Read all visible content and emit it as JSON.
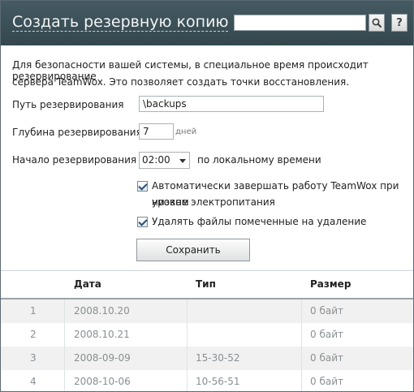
{
  "header": {
    "title": "Создать резервную копию",
    "search_placeholder": "",
    "search_icon": "search-icon",
    "help_label": "?"
  },
  "form": {
    "description_line1": "Для безопасности вашей системы, в специальное время происходит резервирование",
    "description_line2": "сервера TeamWox. Это позволяет создать точки восстановления.",
    "path_label": "Путь резервирования",
    "path_value": "\\backups",
    "depth_label": "Глубина резервирования",
    "depth_value": "7",
    "depth_unit": "дней",
    "start_label": "Начало резервирования в",
    "start_value": "02:00",
    "start_suffix": "по локальному времени",
    "auto_shutdown_line1": "Автоматически завершать работу TeamWox при низком",
    "auto_shutdown_line2": "уровне электропитания",
    "auto_shutdown_checked": true,
    "delete_files_label": "Удалять файлы помеченные на удаление",
    "delete_files_checked": true,
    "save_label": "Сохранить"
  },
  "table": {
    "columns": [
      "",
      "Дата",
      "Тип",
      "Размер"
    ],
    "rows": [
      {
        "num": "1",
        "date": "2008.10.20",
        "type": "",
        "size": "0 байт"
      },
      {
        "num": "2",
        "date": "2008.10.21",
        "type": "",
        "size": "0 байт"
      },
      {
        "num": "3",
        "date": "2008-09-09",
        "type": "15-30-52",
        "size": "0 байт"
      },
      {
        "num": "4",
        "date": "2008-10-06",
        "type": "10-56-51",
        "size": "0 байт"
      }
    ]
  }
}
